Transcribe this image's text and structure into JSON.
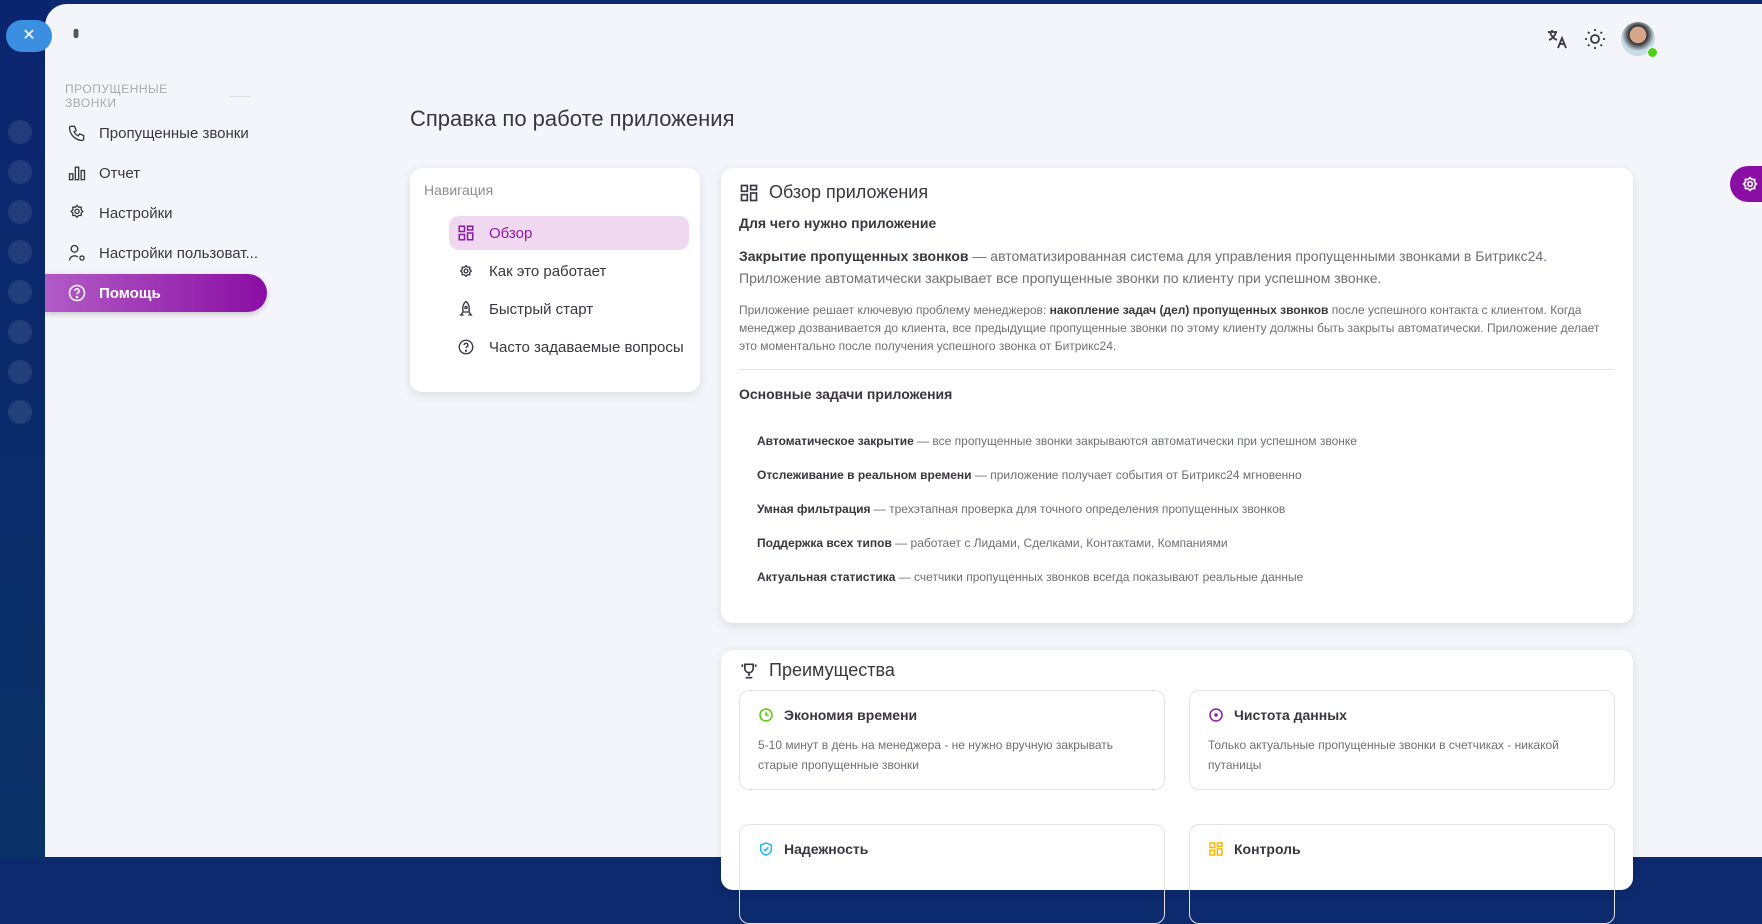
{
  "sidebar": {
    "section": "ПРОПУЩЕННЫЕ ЗВОНКИ",
    "items": [
      {
        "label": "Пропущенные звонки",
        "icon": "phone-icon"
      },
      {
        "label": "Отчет",
        "icon": "bar-chart-icon"
      },
      {
        "label": "Настройки",
        "icon": "gear-icon"
      },
      {
        "label": "Настройки пользоват...",
        "icon": "user-gear-icon"
      },
      {
        "label": "Помощь",
        "icon": "help-icon",
        "active": true
      }
    ]
  },
  "header": {
    "title": "Справка по работе приложения"
  },
  "nav": {
    "title": "Навигация",
    "items": [
      {
        "label": "Обзор",
        "icon": "grid-icon",
        "active": true
      },
      {
        "label": "Как это работает",
        "icon": "gear-icon"
      },
      {
        "label": "Быстрый старт",
        "icon": "rocket-icon"
      },
      {
        "label": "Часто задаваемые вопросы",
        "icon": "help-icon"
      }
    ]
  },
  "overview": {
    "title": "Обзор приложения",
    "subtitle": "Для чего нужно приложение",
    "p1_bold": "Закрытие пропущенных звонков",
    "p1": " — автоматизированная система для управления пропущенными звонками в Битрикс24. Приложение автоматически закрывает все пропущенные звонки по клиенту при успешном звонке.",
    "p2_a": "Приложение решает ключевую проблему менеджеров: ",
    "p2_bold": "накопление задач (дел) пропущенных звонков",
    "p2_b": " после успешного контакта с клиентом. Когда менеджер дозванивается до клиента, все предыдущие пропущенные звонки по этому клиенту должны быть закрыты автоматически. Приложение делает это моментально после получения успешного звонка от Битрикс24.",
    "tasks_title": "Основные задачи приложения",
    "tasks": [
      {
        "b": "Автоматическое закрытие",
        "t": " — все пропущенные звонки закрываются автоматически при успешном звонке"
      },
      {
        "b": "Отслеживание в реальном времени",
        "t": " — приложение получает события от Битрикс24 мгновенно"
      },
      {
        "b": "Умная фильтрация",
        "t": " — трехэтапная проверка для точного определения пропущенных звонков"
      },
      {
        "b": "Поддержка всех типов",
        "t": " — работает с Лидами, Сделками, Контактами, Компаниями"
      },
      {
        "b": "Актуальная статистика",
        "t": " — счетчики пропущенных звонков всегда показывают реальные данные"
      }
    ]
  },
  "advantages": {
    "title": "Преимущества",
    "items": [
      {
        "title": "Экономия времени",
        "text": "5-10 минут в день на менеджера - не нужно вручную закрывать старые пропущенные звонки",
        "color": "#56ca00"
      },
      {
        "title": "Чистота данных",
        "text": "Только актуальные пропущенные звонки в счетчиках - никакой путаницы",
        "color": "#8a1aa3"
      },
      {
        "title": "Надежность",
        "text": "",
        "color": "#16b1ff"
      },
      {
        "title": "Контроль",
        "text": "",
        "color": "#ffb400"
      }
    ]
  },
  "colors": {
    "accent": "#8a0ea3",
    "online": "#4cd11a"
  }
}
